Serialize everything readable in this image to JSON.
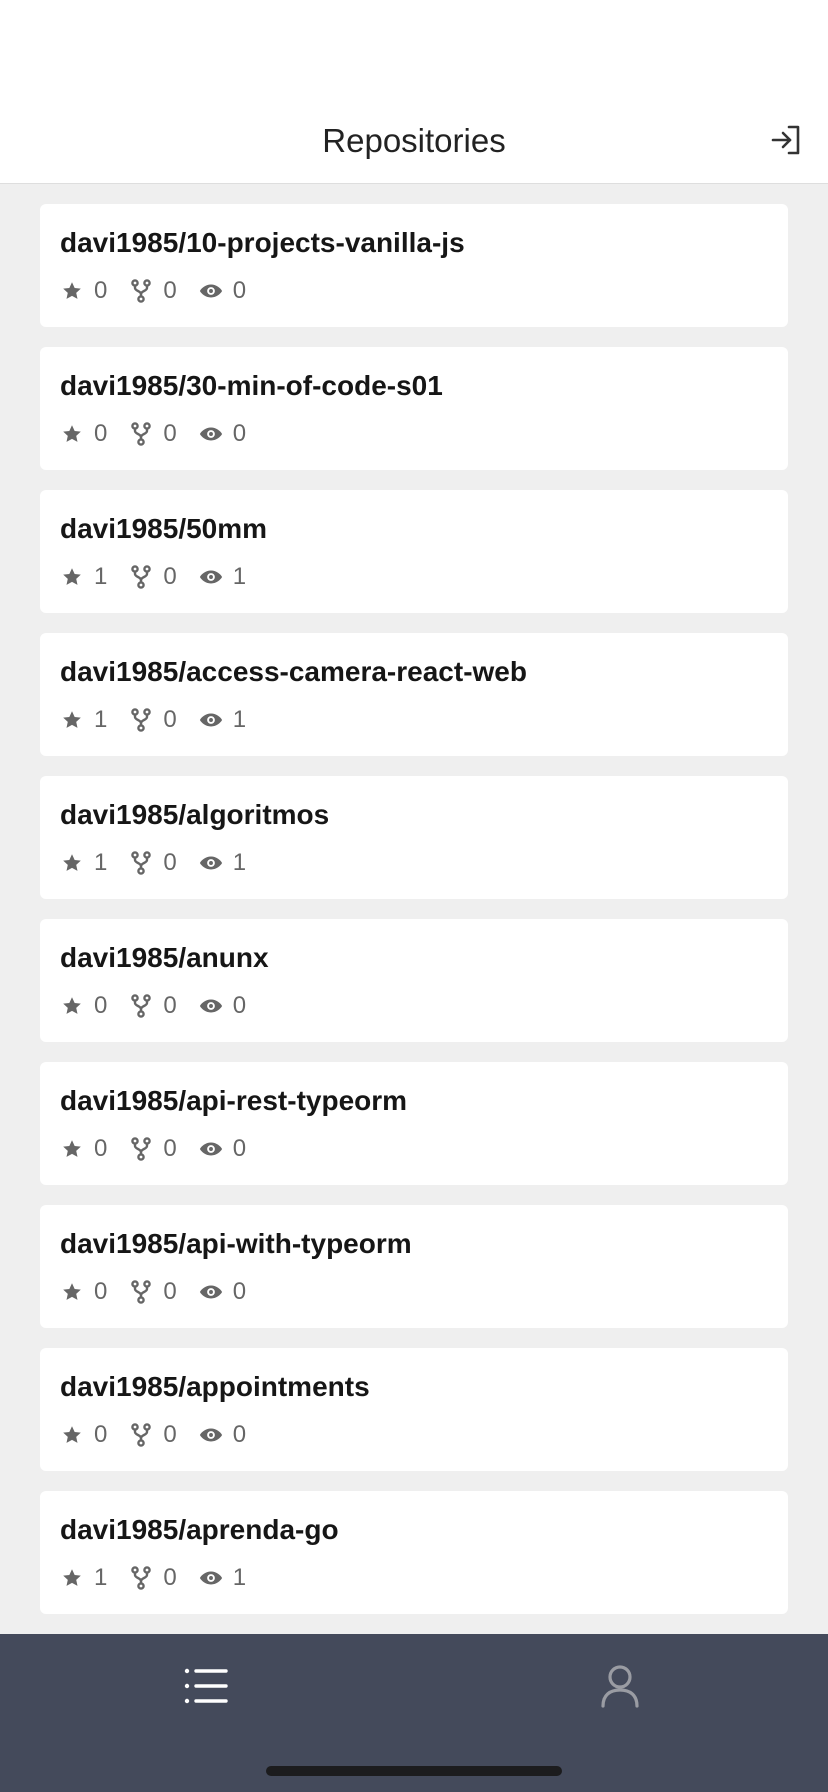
{
  "header": {
    "title": "Repositories",
    "logout_icon": "sign-out-icon"
  },
  "repositories": [
    {
      "name": "davi1985/10-projects-vanilla-js",
      "stars": "0",
      "forks": "0",
      "watchers": "0"
    },
    {
      "name": "davi1985/30-min-of-code-s01",
      "stars": "0",
      "forks": "0",
      "watchers": "0"
    },
    {
      "name": "davi1985/50mm",
      "stars": "1",
      "forks": "0",
      "watchers": "1"
    },
    {
      "name": "davi1985/access-camera-react-web",
      "stars": "1",
      "forks": "0",
      "watchers": "1"
    },
    {
      "name": "davi1985/algoritmos",
      "stars": "1",
      "forks": "0",
      "watchers": "1"
    },
    {
      "name": "davi1985/anunx",
      "stars": "0",
      "forks": "0",
      "watchers": "0"
    },
    {
      "name": "davi1985/api-rest-typeorm",
      "stars": "0",
      "forks": "0",
      "watchers": "0"
    },
    {
      "name": "davi1985/api-with-typeorm",
      "stars": "0",
      "forks": "0",
      "watchers": "0"
    },
    {
      "name": "davi1985/appointments",
      "stars": "0",
      "forks": "0",
      "watchers": "0"
    },
    {
      "name": "davi1985/aprenda-go",
      "stars": "1",
      "forks": "0",
      "watchers": "1"
    }
  ],
  "tabbar": {
    "tabs": [
      {
        "icon": "list-icon",
        "active": true
      },
      {
        "icon": "user-icon",
        "active": false
      }
    ],
    "active_color": "#ffffff",
    "inactive_color": "#9a9ca3"
  },
  "colors": {
    "background": "#efefef",
    "tabbar": "#444a5b",
    "stat_text": "#666666"
  }
}
